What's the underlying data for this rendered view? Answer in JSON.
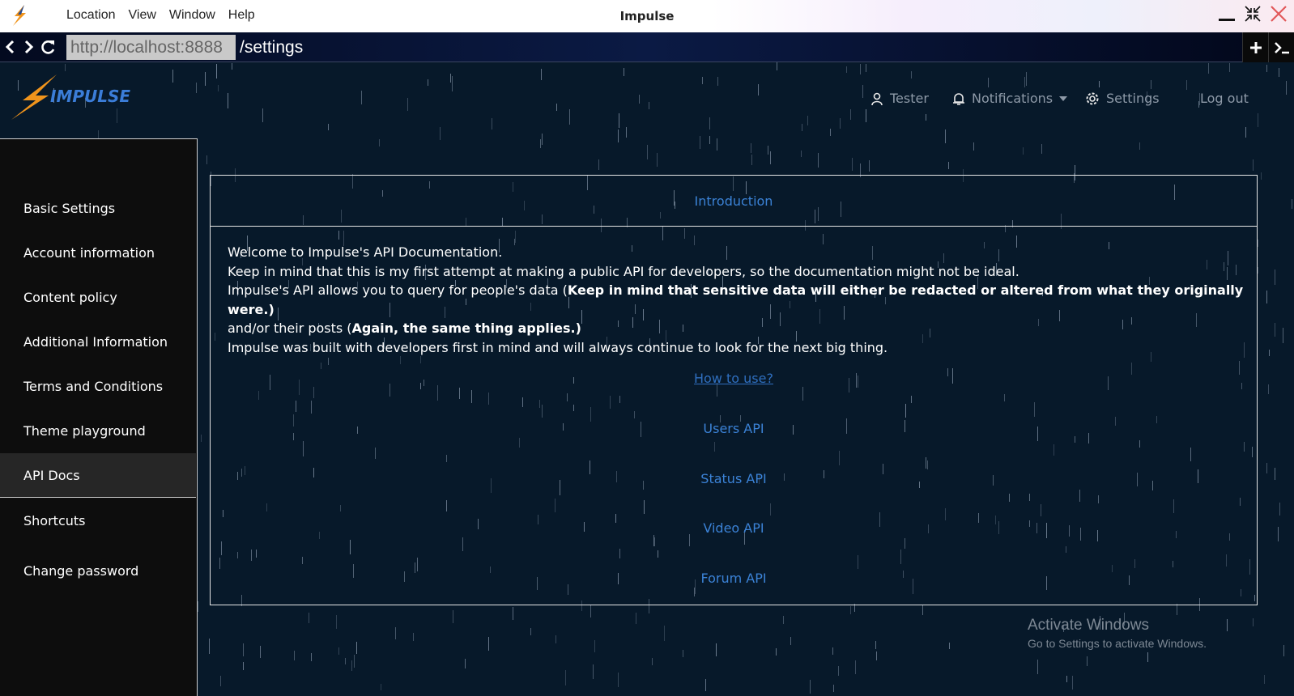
{
  "window": {
    "menu": [
      "Location",
      "View",
      "Window",
      "Help"
    ],
    "title": "Impulse"
  },
  "address": {
    "host": "http://localhost:8888",
    "path": "/settings"
  },
  "header": {
    "logo_text": "IMPULSE",
    "user": "Tester",
    "notifications": "Notifications",
    "settings": "Settings",
    "logout": "Log out"
  },
  "sidebar": {
    "items": [
      {
        "label": "Basic Settings"
      },
      {
        "label": "Account information"
      },
      {
        "label": "Content policy"
      },
      {
        "label": "Additional Information"
      },
      {
        "label": "Terms and Conditions"
      },
      {
        "label": "Theme playground"
      },
      {
        "label": "API Docs"
      },
      {
        "label": "Shortcuts"
      },
      {
        "label": "Change password"
      }
    ],
    "active": "API Docs"
  },
  "docs": {
    "tab": "Introduction",
    "line1": "Welcome to Impulse's API Documentation.",
    "line2": "Keep in mind that this is my first attempt at making a public API for developers, so the documentation might not be ideal.",
    "line3_a": "Impulse's API allows you to query for people's data (",
    "line3_b": "Keep in mind that sensitive data will either be redacted or altered from what they originally were.",
    "line3_c": ")",
    "line4_a": "and/or their posts (",
    "line4_b": "Again, the same thing applies.",
    "line4_c": ")",
    "line5": "Impulse was built with developers first in mind and will always continue to look for the next big thing.",
    "links": [
      "How to use?",
      "Users API",
      "Status API",
      "Video API",
      "Forum API"
    ]
  },
  "watermark": {
    "title": "Activate Windows",
    "subtitle": "Go to Settings to activate Windows."
  },
  "colors": {
    "background": "#07192a",
    "link": "#3b82d6",
    "accent": "#f0941c",
    "sidebar": "#0d0d0d"
  }
}
